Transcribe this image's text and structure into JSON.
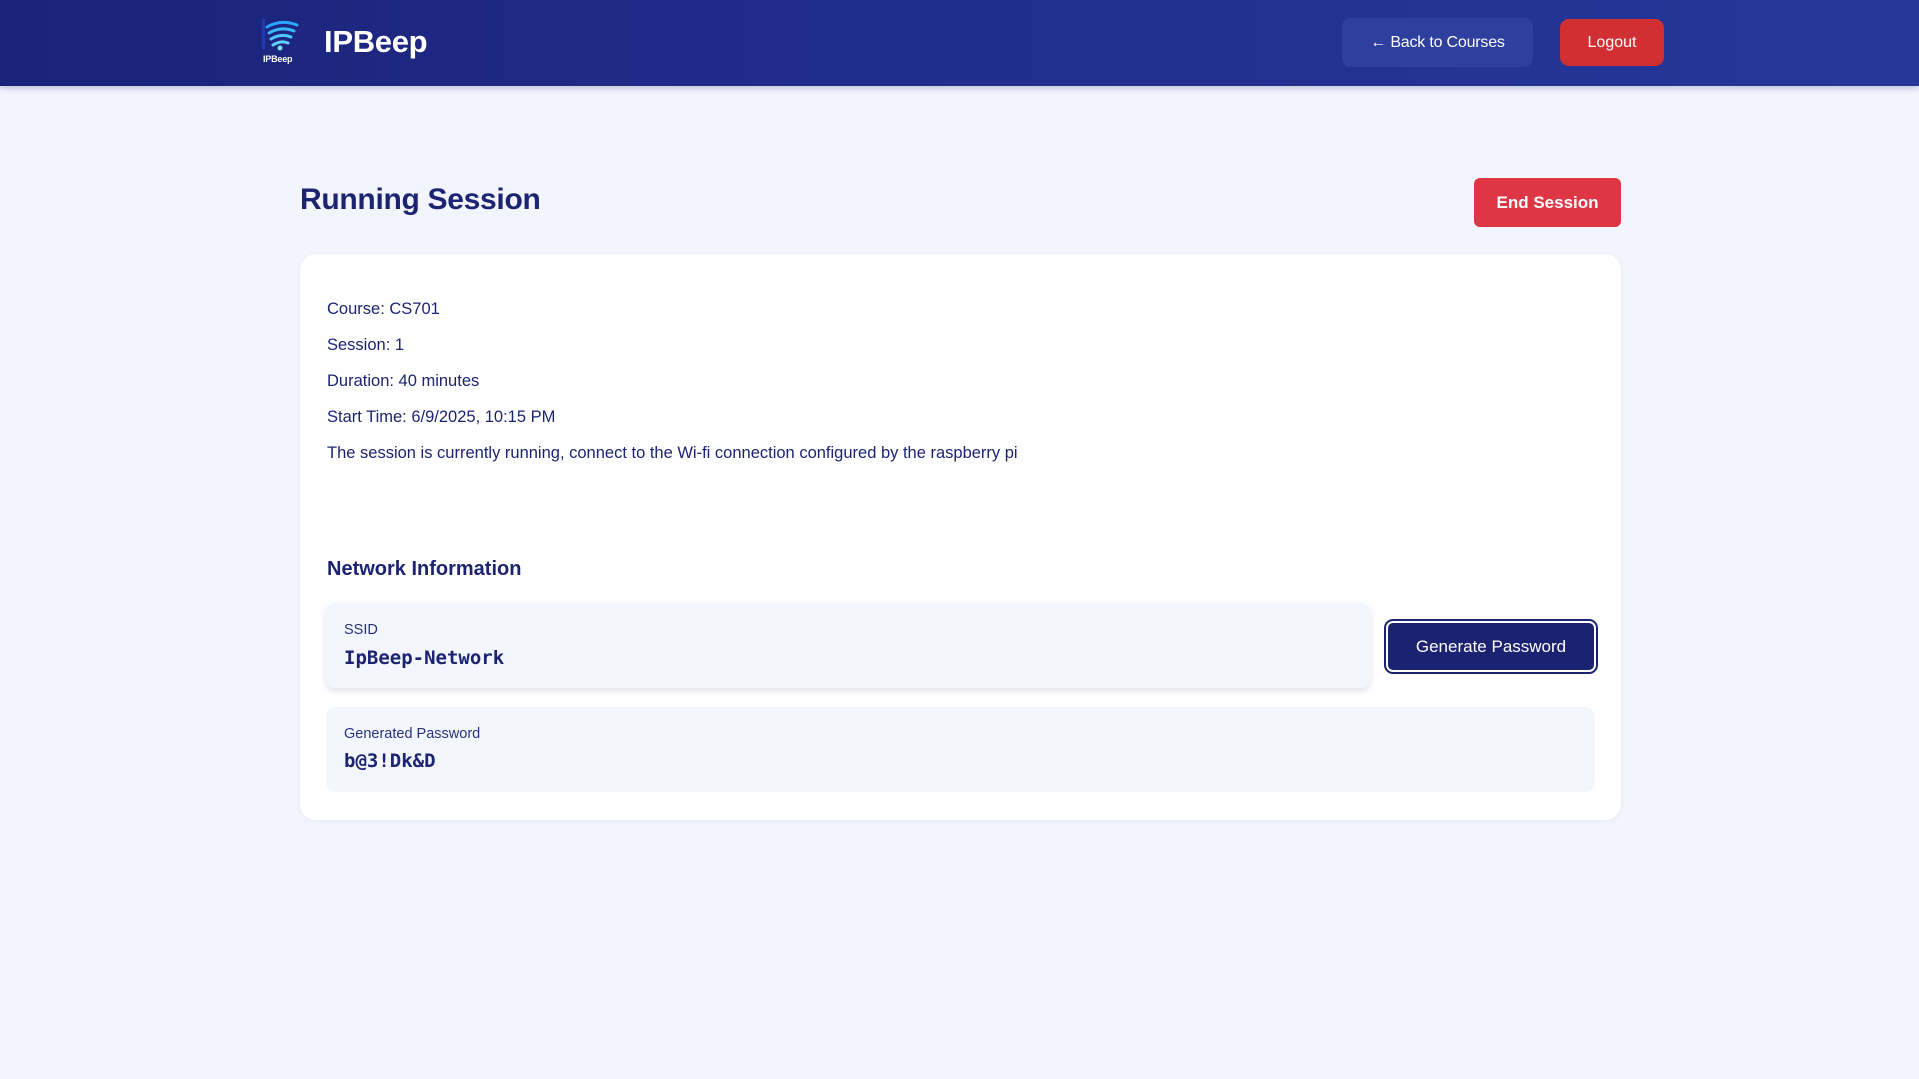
{
  "header": {
    "logo_text": "IPBeep",
    "brand_title": "IPBeep",
    "back_label": "← Back to Courses",
    "logout_label": "Logout"
  },
  "page": {
    "title": "Running Session",
    "end_session_label": "End Session"
  },
  "session": {
    "course": "Course: CS701",
    "session": "Session: 1",
    "duration": "Duration: 40 minutes",
    "start_time": "Start Time: 6/9/2025, 10:15 PM",
    "status_message": "The session is currently running, connect to the Wi-fi connection configured by the raspberry pi"
  },
  "network": {
    "section_title": "Network Information",
    "ssid_label": "SSID",
    "ssid_value": "IpBeep-Network",
    "generate_label": "Generate Password",
    "password_label": "Generated Password",
    "password_value": "b@3!Dk&D"
  },
  "colors": {
    "header_bg": "#1b237a",
    "back_button": "#2e3f9e",
    "logout_button": "#d22f32",
    "end_session_button": "#de3644",
    "primary_button": "#1b2272",
    "page_bg": "#f2f5fd",
    "text_primary": "#1c2472"
  }
}
